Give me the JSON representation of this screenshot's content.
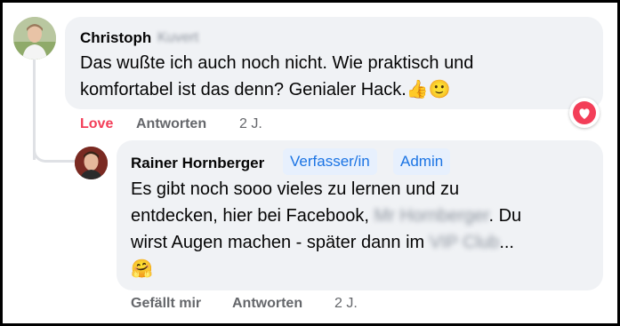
{
  "comment": {
    "author": "Christoph",
    "author_hidden": "Kuvert",
    "text_line1": "Das wußte ich auch noch nicht. Wie praktisch und",
    "text_line2": "komfortabel ist das denn? Genialer Hack.",
    "emojis": "👍🙂",
    "reaction_icon": "love-reaction-icon",
    "actions": {
      "love": "Love",
      "reply": "Antworten",
      "time": "2 J."
    }
  },
  "reply": {
    "author": "Rainer Hornberger",
    "badges": [
      "Verfasser/in",
      "Admin"
    ],
    "text_line1": "Es gibt noch sooo vieles zu lernen und zu",
    "text_line2_a": "entdecken, hier bei Facebook,",
    "text_line2_hidden": "Mr Hornberger",
    "text_line2_b": ". Du",
    "text_line3_a": "wirst Augen machen - später dann im",
    "text_line3_hidden": "VIP Club",
    "text_line3_b": "...",
    "emoji": "🤗",
    "actions": {
      "like": "Gefällt mir",
      "reply": "Antworten",
      "time": "2 J."
    }
  },
  "colors": {
    "bubble": "#f0f2f5",
    "love": "#f33e58",
    "badge_text": "#1b74e4",
    "badge_bg": "#e7f0fd",
    "meta": "#65676b"
  }
}
